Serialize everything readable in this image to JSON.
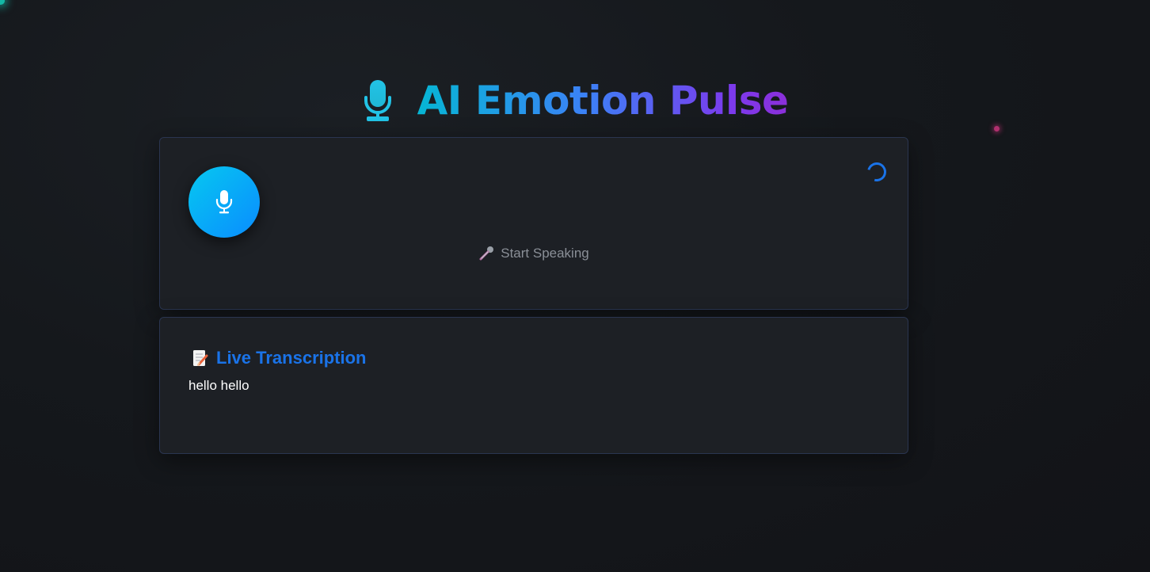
{
  "header": {
    "icon": "microphone-icon",
    "title": "AI Emotion Pulse",
    "gradient_colors": [
      "#06b6d4",
      "#3b82f6",
      "#7c3aed"
    ]
  },
  "recorder": {
    "mic_button_icon": "microphone-icon",
    "status_icon": "microphone-icon",
    "status_text": "Start Speaking",
    "loading_indicator": "spinner-icon"
  },
  "transcription": {
    "icon": "memo-icon",
    "title": "Live Transcription",
    "text": "hello hello"
  },
  "colors": {
    "background": "#15181c",
    "card": "#1d2025",
    "accent": "#1a73e8",
    "mic_button": "#0a8cff"
  }
}
